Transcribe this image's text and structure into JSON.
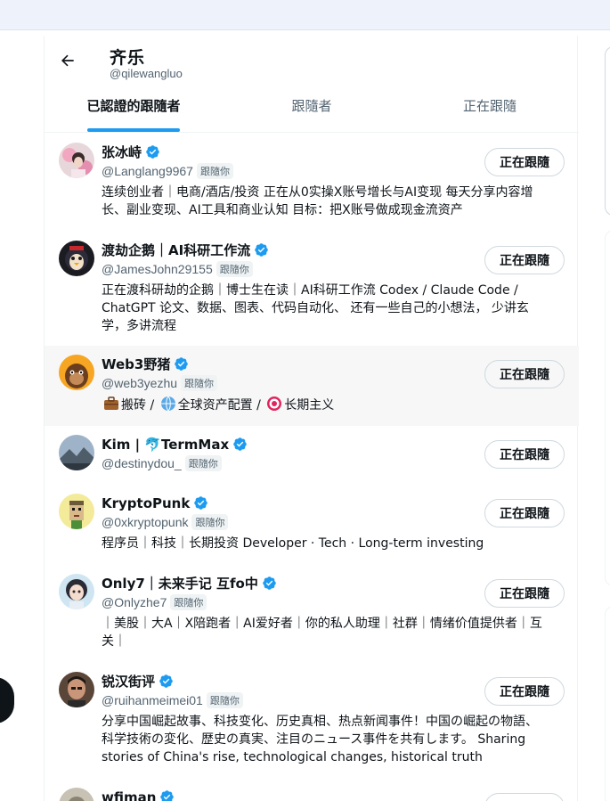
{
  "header": {
    "name": "齐乐",
    "handle": "@qilewangluo"
  },
  "tabs": [
    {
      "label": "已認證的跟隨者",
      "active": true
    },
    {
      "label": "跟隨者",
      "active": false
    },
    {
      "label": "正在跟隨",
      "active": false
    }
  ],
  "follows_you_label": "跟隨你",
  "following_button_label": "正在跟隨",
  "users": [
    {
      "name": "张冰峙",
      "handle": "@Langlang9967",
      "bio": "连续创业者｜电商/酒店/投资 正在从0实操X账号增长与AI变现 每天分享内容增长、副业变现、AI工具和商业认知 目标：把X账号做成现金流资产",
      "avatar": "flower-girl-avatar"
    },
    {
      "name": "渡劫企鹅｜AI科研工作流",
      "handle": "@JamesJohn29155",
      "bio": "正在渡科研劫的企鹅｜博士生在读｜AI科研工作流 Codex / Claude Code / ChatGPT 论文、数据、图表、代码自动化、 还有一些自己的小想法， 少讲玄学，多讲流程",
      "avatar": "penguin-avatar"
    },
    {
      "name": "Web3野猪",
      "handle": "@web3yezhu",
      "bio_parts": [
        "搬砖 / ",
        "全球资产配置 / ",
        "长期主义"
      ],
      "avatar": "ape-avatar"
    },
    {
      "name": "Kim | 🐬TermMax",
      "handle": "@destinydou_",
      "bio": "",
      "avatar": "landscape-avatar"
    },
    {
      "name": "KryptoPunk",
      "handle": "@0xkryptopunk",
      "bio": "程序员｜科技｜长期投资 Developer · Tech · Long-term investing",
      "avatar": "punk-avatar"
    },
    {
      "name": "Only7｜未来手记 互fo中",
      "handle": "@Onlyzhe7",
      "bio": "｜美股｜大A｜X陪跑者｜AI爱好者｜你的私人助理｜社群｜情绪价值提供者｜互关｜",
      "avatar": "anime-girl-avatar"
    },
    {
      "name": "锐汉街评",
      "handle": "@ruihanmeimei01",
      "bio": "分享中国崛起故事、科技变化、历史真相、热点新闻事件！中国の崛起の物語、科学技術の変化、歴史の真実、注目のニュース事件を共有します。 Sharing stories of China's rise, technological changes, historical truth",
      "avatar": "man-avatar"
    },
    {
      "name": "wfiman",
      "handle": "",
      "bio": "",
      "avatar": "partial-avatar"
    }
  ],
  "colors": {
    "accent": "#1d9bf0",
    "secondary_text": "#536471",
    "hover_row": "#f7f7f7"
  }
}
